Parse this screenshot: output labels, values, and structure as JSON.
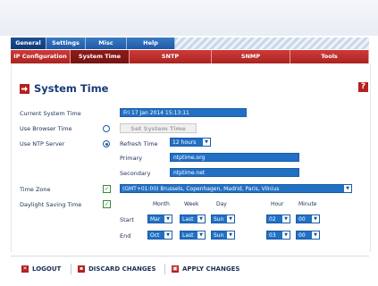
{
  "primary_tabs": [
    {
      "label": "General",
      "active": true
    },
    {
      "label": "Settings",
      "active": false
    },
    {
      "label": "Misc",
      "active": false
    },
    {
      "label": "Help",
      "active": false
    }
  ],
  "secondary_tabs": [
    {
      "label": "IP Configuration",
      "active": false
    },
    {
      "label": "System Time",
      "active": true
    },
    {
      "label": "SNTP",
      "active": false
    },
    {
      "label": "SNMP",
      "active": false
    },
    {
      "label": "Tools",
      "active": false
    }
  ],
  "page": {
    "title": "System Time",
    "help_label": "?"
  },
  "form": {
    "current_time_label": "Current System Time",
    "current_time_value": "Fri 17 Jan 2014 15:13:11",
    "browser_time_label": "Use Browser Time",
    "set_time_button": "Set System Time",
    "ntp_label": "Use NTP Server",
    "refresh_label": "Refresh Time",
    "refresh_value": "12 hours",
    "primary_label": "Primary",
    "primary_value": "ntptime.org",
    "secondary_label": "Secondary",
    "secondary_value": "ntptime.net",
    "timezone_label": "Time Zone",
    "timezone_value": "(GMT+01:00) Brussels, Copenhagen, Madrid, Paris, Vilnius",
    "dst_label": "Daylight Saving Time",
    "dst_checked": true,
    "timezone_checked": true,
    "radio_selected": "ntp",
    "dst_columns": {
      "month": "Month",
      "week": "Week",
      "day": "Day",
      "hour": "Hour",
      "minute": "Minute"
    },
    "start_label": "Start",
    "start": {
      "month": "Mar",
      "week": "Last",
      "day": "Sun",
      "hour": "02",
      "minute": "00"
    },
    "end_label": "End",
    "end": {
      "month": "Oct",
      "week": "Last",
      "day": "Sun",
      "hour": "03",
      "minute": "00"
    }
  },
  "footer": {
    "logout": "LOGOUT",
    "discard": "DISCARD CHANGES",
    "apply": "APPLY CHANGES"
  },
  "colors": {
    "accent_blue": "#2170c4",
    "accent_red": "#b52020",
    "title_blue": "#1b3a78"
  }
}
